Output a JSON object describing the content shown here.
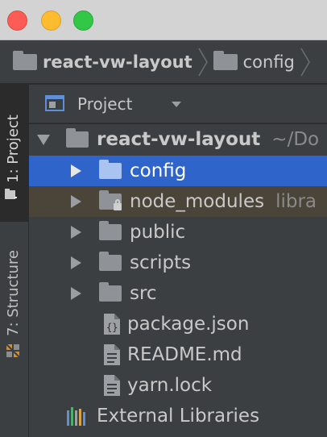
{
  "window": {
    "controls": [
      "close",
      "minimize",
      "maximize"
    ]
  },
  "navbar": {
    "root": "react-vw-layout",
    "current": "config"
  },
  "toolstrip": {
    "project_tab": "1: Project",
    "structure_tab": "7: Structure"
  },
  "panel": {
    "title": "Project"
  },
  "tree": {
    "root": {
      "label": "react-vw-layout",
      "hint": "~/Do"
    },
    "items": [
      {
        "label": "config",
        "type": "folder",
        "selected": true
      },
      {
        "label": "node_modules",
        "type": "folder-locked",
        "hint": "libra"
      },
      {
        "label": "public",
        "type": "folder"
      },
      {
        "label": "scripts",
        "type": "folder"
      },
      {
        "label": "src",
        "type": "folder"
      },
      {
        "label": "package.json",
        "type": "json-file"
      },
      {
        "label": "README.md",
        "type": "text-file"
      },
      {
        "label": "yarn.lock",
        "type": "text-file"
      }
    ],
    "external": {
      "label": "External Libraries"
    }
  },
  "colors": {
    "selection": "#2f65ca",
    "excluded_row": "#4a4439",
    "panel_bg": "#3c3f41"
  }
}
